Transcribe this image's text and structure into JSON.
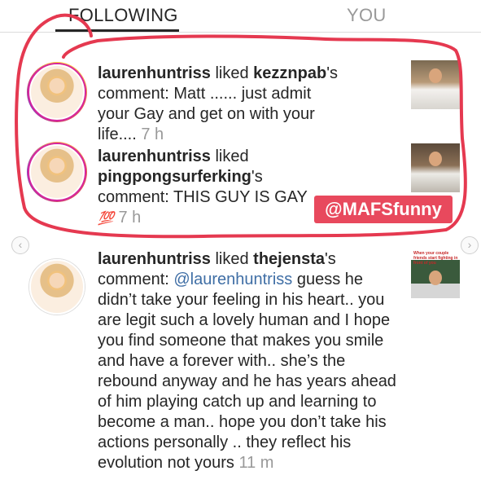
{
  "tabs": {
    "following": "FOLLOWING",
    "you": "YOU"
  },
  "activity": [
    {
      "user": "laurenhuntriss",
      "action": " liked ",
      "target": "kezznpab",
      "suffix": "'s comment: ",
      "comment": "Matt ...... just admit your Gay and get on with your life....",
      "time": "7 h"
    },
    {
      "user": "laurenhuntriss",
      "action": " liked ",
      "target": "pingpongsurferking",
      "suffix": "'s comment: ",
      "comment": "THIS GUY IS GAY",
      "emoji": "💯",
      "time": "7 h"
    },
    {
      "user": "laurenhuntriss",
      "action": " liked ",
      "target": "thejensta",
      "suffix": "'s comment: ",
      "mention": "@laurenhuntriss",
      "comment": " guess he didn’t take your feeling in his heart.. you are legit such a lovely human and I hope you find someone that makes you smile and have a forever with.. she’s the rebound anyway and he has years ahead of him playing catch up and learning to become a man.. hope you don’t take his actions personally .. they reflect his evolution not yours",
      "time": "11 m"
    }
  ],
  "watermark": "@MAFSfunny",
  "thumb_caption": "When your couple friends start fighting in front of you",
  "icons": {
    "prev": "chevron-left-icon",
    "next": "chevron-right-icon"
  },
  "colors": {
    "scribble": "#e53950",
    "watermark_bg": "#e8495d",
    "time": "#999999",
    "mention": "#3f6ea5"
  }
}
